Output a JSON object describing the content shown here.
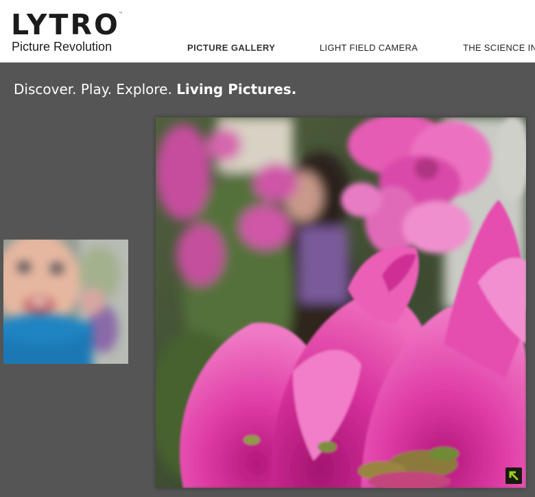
{
  "header": {
    "logo": {
      "word": "LYTRO",
      "trademark": "™",
      "tagline": "Picture Revolution"
    },
    "nav": [
      {
        "label": "PICTURE GALLERY",
        "active": true
      },
      {
        "label": "LIGHT FIELD CAMERA",
        "active": false
      },
      {
        "label": "THE SCIENCE INSIDE",
        "active": false
      }
    ]
  },
  "tagline": {
    "plain": "Discover. Play. Explore. ",
    "strong": "Living Pictures."
  },
  "gallery": {
    "thumbnail_subject": "child portrait",
    "main_subject": "pink flowers with person in background",
    "expand_icon": "arrow-up-left-icon"
  },
  "colors": {
    "page_background": "#555555",
    "header_background": "#ffffff",
    "text_dark": "#1b1b1b",
    "flower_pink": "#e23ea6",
    "expand_arrow": "#9bd11b"
  }
}
